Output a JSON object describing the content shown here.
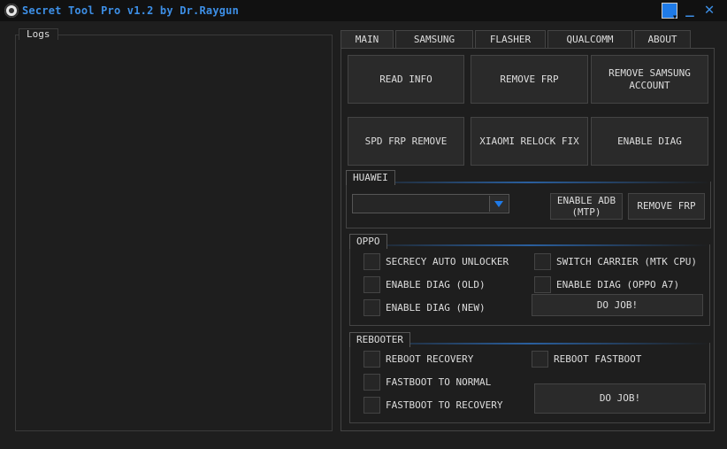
{
  "window": {
    "title": "Secret Tool Pro v1.2 by Dr.Raygun",
    "accent": "#3d8fe6"
  },
  "logs": {
    "label": "Logs"
  },
  "tabs": [
    "MAIN",
    "SAMSUNG",
    "FLASHER",
    "QUALCOMM",
    "ABOUT"
  ],
  "main_buttons": {
    "read_info": "READ INFO",
    "remove_frp": "REMOVE FRP",
    "remove_samsung_1": "REMOVE SAMSUNG",
    "remove_samsung_2": "ACCOUNT",
    "spd_frp": "SPD FRP REMOVE",
    "xiaomi": "XIAOMI RELOCK FIX",
    "enable_diag": "ENABLE DIAG"
  },
  "huawei": {
    "label": "HUAWEI",
    "combo_value": "",
    "enable_adb_1": "ENABLE ADB",
    "enable_adb_2": "(MTP)",
    "remove_frp": "REMOVE FRP"
  },
  "oppo": {
    "label": "OPPO",
    "options": [
      "SECRECY AUTO UNLOCKER",
      "SWITCH CARRIER (MTK CPU)",
      "ENABLE DIAG (OLD)",
      "ENABLE DIAG (OPPO A7)",
      "ENABLE DIAG (NEW)"
    ],
    "do_job": "DO JOB!"
  },
  "rebooter": {
    "label": "REBOOTER",
    "options": [
      "REBOOT RECOVERY",
      "REBOOT FASTBOOT",
      "FASTBOOT TO NORMAL",
      "FASTBOOT TO RECOVERY"
    ],
    "do_job": "DO JOB!"
  }
}
